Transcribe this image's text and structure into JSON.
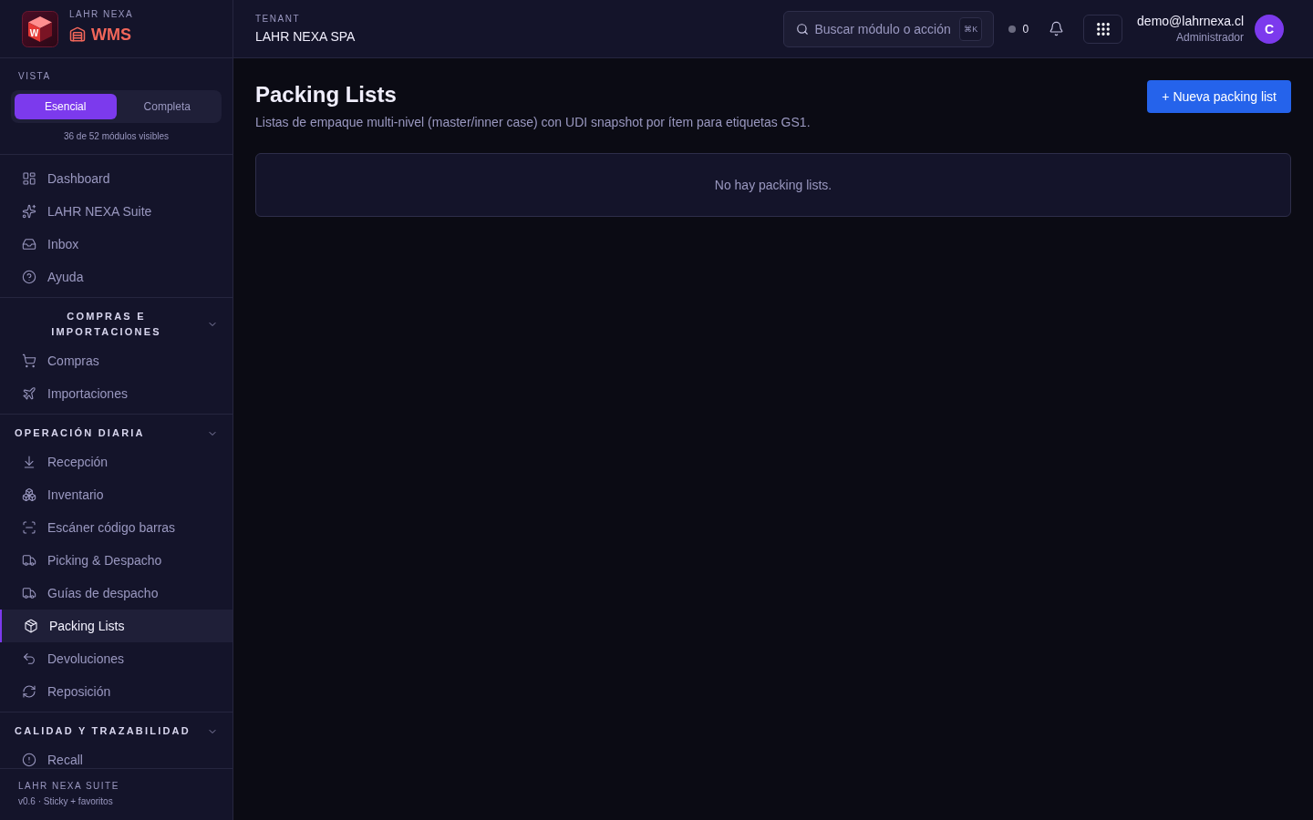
{
  "brand": {
    "overline": "LAHR NEXA",
    "name": "WMS",
    "logo_letter": "W"
  },
  "view_toggle": {
    "label": "VISTA",
    "options": [
      {
        "label": "Esencial",
        "selected": true
      },
      {
        "label": "Completa",
        "selected": false
      }
    ],
    "caption": "36 de 52 módulos visibles"
  },
  "sidebar": {
    "groups": [
      {
        "items": [
          {
            "label": "Dashboard",
            "selected": false
          },
          {
            "label": "LAHR NEXA Suite",
            "selected": false
          },
          {
            "label": "Inbox",
            "selected": false
          },
          {
            "label": "Ayuda",
            "selected": false
          }
        ]
      },
      {
        "title": "COMPRAS E IMPORTACIONES",
        "expanded": true,
        "items": [
          {
            "label": "Compras",
            "selected": false
          },
          {
            "label": "Importaciones",
            "selected": false
          }
        ]
      },
      {
        "title": "OPERACIÓN DIARIA",
        "expanded": true,
        "items": [
          {
            "label": "Recepción",
            "selected": false
          },
          {
            "label": "Inventario",
            "selected": false
          },
          {
            "label": "Escáner código barras",
            "selected": false
          },
          {
            "label": "Picking & Despacho",
            "selected": false
          },
          {
            "label": "Guías de despacho",
            "selected": false
          },
          {
            "label": "Packing Lists",
            "selected": true
          },
          {
            "label": "Devoluciones",
            "selected": false
          },
          {
            "label": "Reposición",
            "selected": false
          }
        ]
      },
      {
        "title": "CALIDAD Y TRAZABILIDAD",
        "expanded": true,
        "items": [
          {
            "label": "Recall",
            "selected": false
          }
        ]
      }
    ]
  },
  "footer": {
    "title": "LAHR NEXA SUITE",
    "version": "v0.6 · Sticky + favoritos"
  },
  "topbar": {
    "tenant_label": "TENANT",
    "tenant": "LAHR NEXA SPA",
    "search": {
      "placeholder": "Buscar módulo o acción",
      "shortcut": "⌘K"
    },
    "status_count": "0",
    "user": {
      "email": "demo@lahrnexa.cl",
      "role": "Administrador",
      "initial": "C"
    }
  },
  "page": {
    "title": "Packing Lists",
    "subtitle": "Listas de empaque multi-nivel (master/inner case) con UDI snapshot por ítem para etiquetas GS1.",
    "new_button": "+ Nueva packing list",
    "empty_message": "No hay packing lists."
  }
}
